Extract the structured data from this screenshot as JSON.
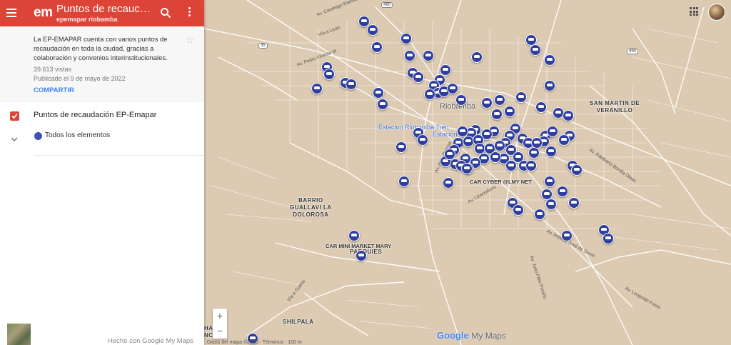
{
  "header": {
    "logo_text": "em",
    "title": "Puntos de recaucación EP-Emapar",
    "subtitle": "epemapar riobamba",
    "menu_icon": "hamburger-icon",
    "search_icon": "search-icon",
    "more_icon": "more-vert-icon",
    "color": "#db4437"
  },
  "info": {
    "description": "La EP-EMAPAR cuenta con varios puntos de recaudación en toda la ciudad, gracias a colaboración y convenios interinstitucionales.",
    "views": "39.613 vistas",
    "published": "Publicado el 9 de mayo de 2022",
    "share_label": "COMPARTIR"
  },
  "layers": [
    {
      "title": "Puntos de recaudación EP-Emapar",
      "checked": true,
      "items_label": "Todos los elementos"
    }
  ],
  "footer": {
    "made_with": "Hecho con Google My Maps",
    "map_data": "Datos del mapa ©2025 · Términos · 100 m"
  },
  "map": {
    "zoom_in": "+",
    "zoom_out": "−",
    "logo_google": "Google",
    "logo_mymaps": "My Maps",
    "marker_color": "#303f9f",
    "land_color": "#dccab2",
    "places": [
      {
        "text": "Riobamba",
        "cls": "big"
      },
      {
        "text": "Estacion Riobamba Tren",
        "cls": "station"
      },
      {
        "text": "Estación",
        "cls": "station"
      },
      {
        "text": "SAN MARTIN DE\nVERANILLO",
        "cls": ""
      },
      {
        "text": "BARRIO\nGUALLAVI LA\nDOLOROSA",
        "cls": ""
      },
      {
        "text": "CAR CYBER @LMY NET",
        "cls": "poi"
      },
      {
        "text": "CAR MINI MARKET MARY",
        "cls": "poi"
      },
      {
        "text": "PARQUIES",
        "cls": ""
      },
      {
        "text": "SHILPALA",
        "cls": ""
      },
      {
        "text": "HA\nNCA",
        "cls": ""
      }
    ],
    "roads": [
      "Av. Pedro Vicente M.",
      "Av. Canónigo Ramos",
      "Av. Leopoldo Freire",
      "Av. Edelberto Bonilla Oleas",
      "Av. Antonio José de Sucre",
      "Av. Juan Félix Proaño",
      "Vía a Guano",
      "Av. de la Prensa",
      "Av. Lizarzaburu",
      "Vía a Licán"
    ],
    "highways": [
      "35",
      "490",
      "490"
    ]
  }
}
